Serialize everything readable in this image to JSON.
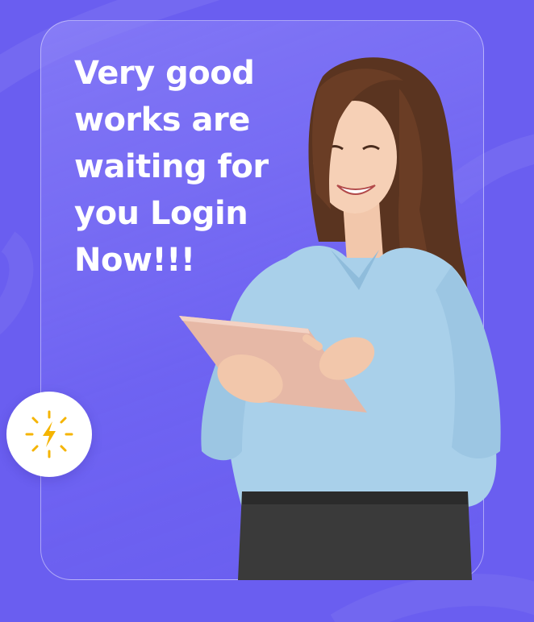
{
  "hero": {
    "headline": "Very good\nworks are\nwaiting for\nyou Login\nNow!!!"
  },
  "badge": {
    "icon": "lightning-sparkle-icon",
    "icon_color": "#f5b400"
  },
  "colors": {
    "background": "#6a5ef0",
    "card_border": "#ffffff",
    "text": "#ffffff",
    "shirt": "#a9d0ea",
    "skirt": "#3a3a3a",
    "hair": "#5a3420",
    "tablet": "#e6b8a6"
  },
  "illustration": {
    "subject": "woman-using-tablet"
  }
}
